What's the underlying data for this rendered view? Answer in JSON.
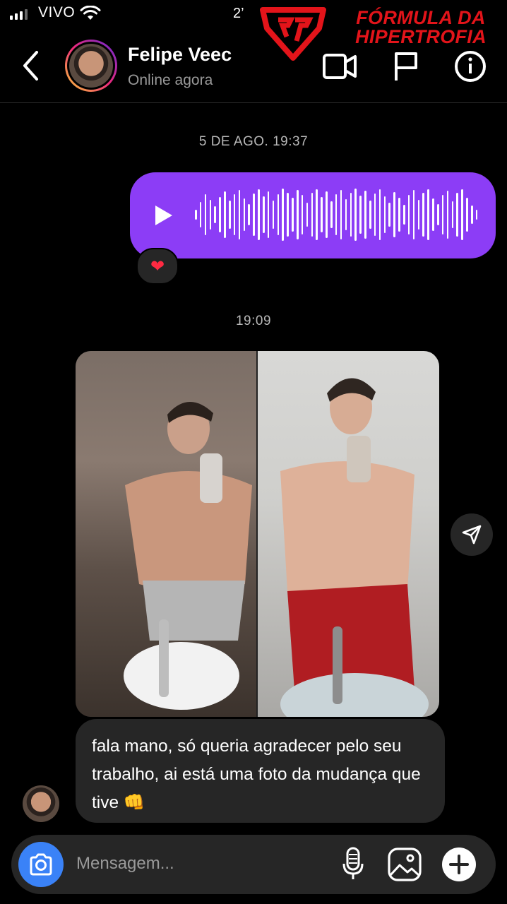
{
  "status_bar": {
    "carrier": "VIVO",
    "time": "2’"
  },
  "brand": {
    "line1": "FÓRMULA DA",
    "line2": "HIPERTROFIA"
  },
  "header": {
    "contact_name": "Felipe Veec",
    "contact_status": "Online agora"
  },
  "thread": {
    "date_separator_1": "5 DE AGO. 19:37",
    "audio_reaction": "❤",
    "date_separator_2": "19:09",
    "incoming_text": "fala mano, só queria agradecer pelo seu trabalho, ai está uma foto da mudança que tive 👊"
  },
  "composer": {
    "placeholder": "Mensagem..."
  },
  "colors": {
    "audio_bubble": "#8c3df6",
    "camera_button": "#3a82f7",
    "brand_red": "#e3141a"
  },
  "icons": [
    "back-icon",
    "video-call-icon",
    "flag-icon",
    "info-icon",
    "play-icon",
    "heart-icon",
    "share-icon",
    "camera-icon",
    "microphone-icon",
    "gallery-icon",
    "plus-icon"
  ]
}
